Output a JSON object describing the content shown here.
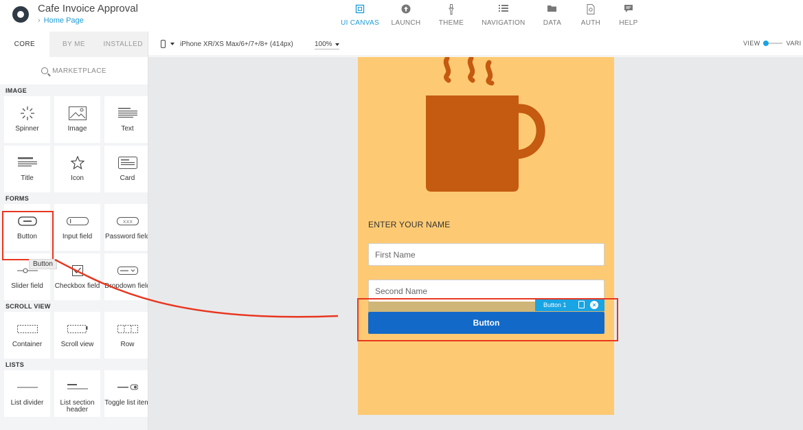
{
  "header": {
    "app_title": "Cafe Invoice Approval",
    "breadcrumb": "Home Page",
    "nav": [
      {
        "label": "UI CANVAS",
        "icon": "canvas-icon",
        "active": true
      },
      {
        "label": "LAUNCH",
        "icon": "launch-icon",
        "active": false
      },
      {
        "label": "THEME",
        "icon": "theme-icon",
        "active": false
      },
      {
        "label": "NAVIGATION",
        "icon": "navigation-icon",
        "active": false
      },
      {
        "label": "DATA",
        "icon": "folder-icon",
        "active": false
      },
      {
        "label": "AUTH",
        "icon": "auth-icon",
        "active": false
      },
      {
        "label": "HELP",
        "icon": "help-icon",
        "active": false
      }
    ]
  },
  "sidebar": {
    "tabs": [
      "CORE",
      "BY ME",
      "INSTALLED"
    ],
    "active_tab": "CORE",
    "marketplace": "MARKETPLACE",
    "sections": {
      "image": {
        "title": "IMAGE",
        "items": [
          {
            "label": "Spinner",
            "icon": "spinner-icon"
          },
          {
            "label": "Image",
            "icon": "image-icon"
          },
          {
            "label": "Text",
            "icon": "text-icon"
          },
          {
            "label": "Title",
            "icon": "title-icon"
          },
          {
            "label": "Icon",
            "icon": "star-icon"
          },
          {
            "label": "Card",
            "icon": "card-icon"
          }
        ]
      },
      "forms": {
        "title": "FORMS",
        "items": [
          {
            "label": "Button",
            "icon": "button-icon"
          },
          {
            "label": "Input field",
            "icon": "input-field-icon"
          },
          {
            "label": "Password field",
            "icon": "password-field-icon"
          },
          {
            "label": "Slider field",
            "icon": "slider-icon"
          },
          {
            "label": "Checkbox field",
            "icon": "checkbox-icon"
          },
          {
            "label": "Dropdown field",
            "icon": "dropdown-icon"
          }
        ]
      },
      "scroll_view": {
        "title": "SCROLL VIEW",
        "items": [
          {
            "label": "Container",
            "icon": "container-icon"
          },
          {
            "label": "Scroll view",
            "icon": "scroll-view-icon"
          },
          {
            "label": "Row",
            "icon": "row-icon"
          }
        ]
      },
      "lists": {
        "title": "LISTS",
        "items": [
          {
            "label": "List divider",
            "icon": "list-divider-icon"
          },
          {
            "label": "List section header",
            "icon": "list-section-header-icon"
          },
          {
            "label": "Toggle list item",
            "icon": "toggle-list-item-icon"
          }
        ]
      }
    },
    "tooltip": "Button"
  },
  "toolbar": {
    "device": "iPhone XR/XS Max/6+/7+/8+ (414px)",
    "zoom": "100%",
    "view_label": "VIEW",
    "vari_label": "VARI"
  },
  "canvas": {
    "enter_name_label": "ENTER YOUR NAME",
    "first_name_placeholder": "First Name",
    "second_name_placeholder": "Second Name",
    "button_label": "Button",
    "selection_tag": "Button 1",
    "colors": {
      "phone_bg": "#fdca73",
      "mug": "#c55a11",
      "button": "#1269c7",
      "selection": "#19a4e4",
      "annotation": "#e8361f"
    }
  }
}
